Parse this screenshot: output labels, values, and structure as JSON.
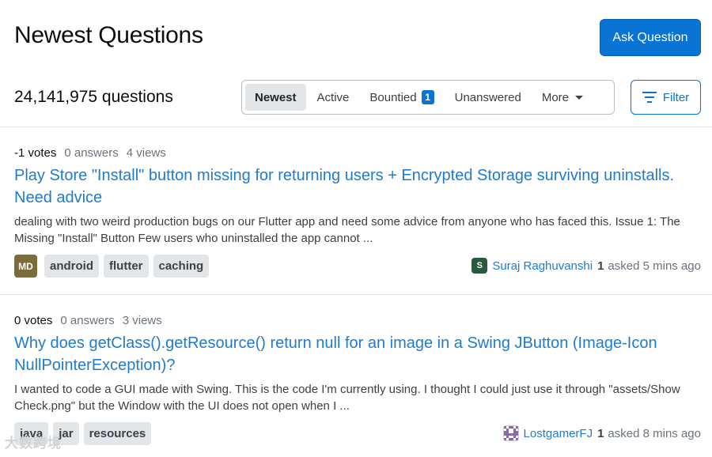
{
  "header": {
    "title": "Newest Questions",
    "ask_button": "Ask Question"
  },
  "summary": {
    "count": "24,141,975 questions"
  },
  "tabs": [
    {
      "label": "Newest",
      "active": true
    },
    {
      "label": "Active",
      "active": false
    },
    {
      "label": "Bountied",
      "badge": "1",
      "active": false
    },
    {
      "label": "Unanswered",
      "active": false
    },
    {
      "label": "More",
      "dropdown": true,
      "active": false
    }
  ],
  "filter": {
    "label": "Filter",
    "icon": "filter-icon"
  },
  "questions": [
    {
      "votes": "-1 votes",
      "answers": "0 answers",
      "views": "4 views",
      "title": "Play Store \"Install\" button missing for returning users + Encrypted Storage surviving uninstalls. Need advice",
      "excerpt": "dealing with two weird production bugs on our Flutter app and need some advice from anyone who has faced this. Issue 1: The Missing \"Install\" Button Few users who uninstalled the app cannot ...",
      "tag_avatar": "MD",
      "tags": [
        "android",
        "flutter",
        "caching"
      ],
      "user": {
        "avatar": "S",
        "name": "Suraj Raghuvanshi",
        "rep": "1",
        "time": "asked 5 mins ago"
      }
    },
    {
      "votes": "0 votes",
      "answers": "0 answers",
      "views": "3 views",
      "title": "Why does getClass().getResource() return null for an image in a Swing JButton (Image-Icon NullPointerException)?",
      "excerpt": "I wanted to code a GUI made with Swing. This is the code I'm currently using. I thought I could just use it through \"assets/Show Check.png\" but the Window with the UI does not open when I ...",
      "tags": [
        "java",
        "jar",
        "resources"
      ],
      "user": {
        "name": "LostgamerFJ",
        "rep": "1",
        "time": "asked 8 mins ago"
      }
    }
  ],
  "watermark": "大数跨境",
  "colors": {
    "accent": "#0a74d4",
    "link": "#1f7bd1",
    "tag_bg": "#e3e6e8"
  }
}
